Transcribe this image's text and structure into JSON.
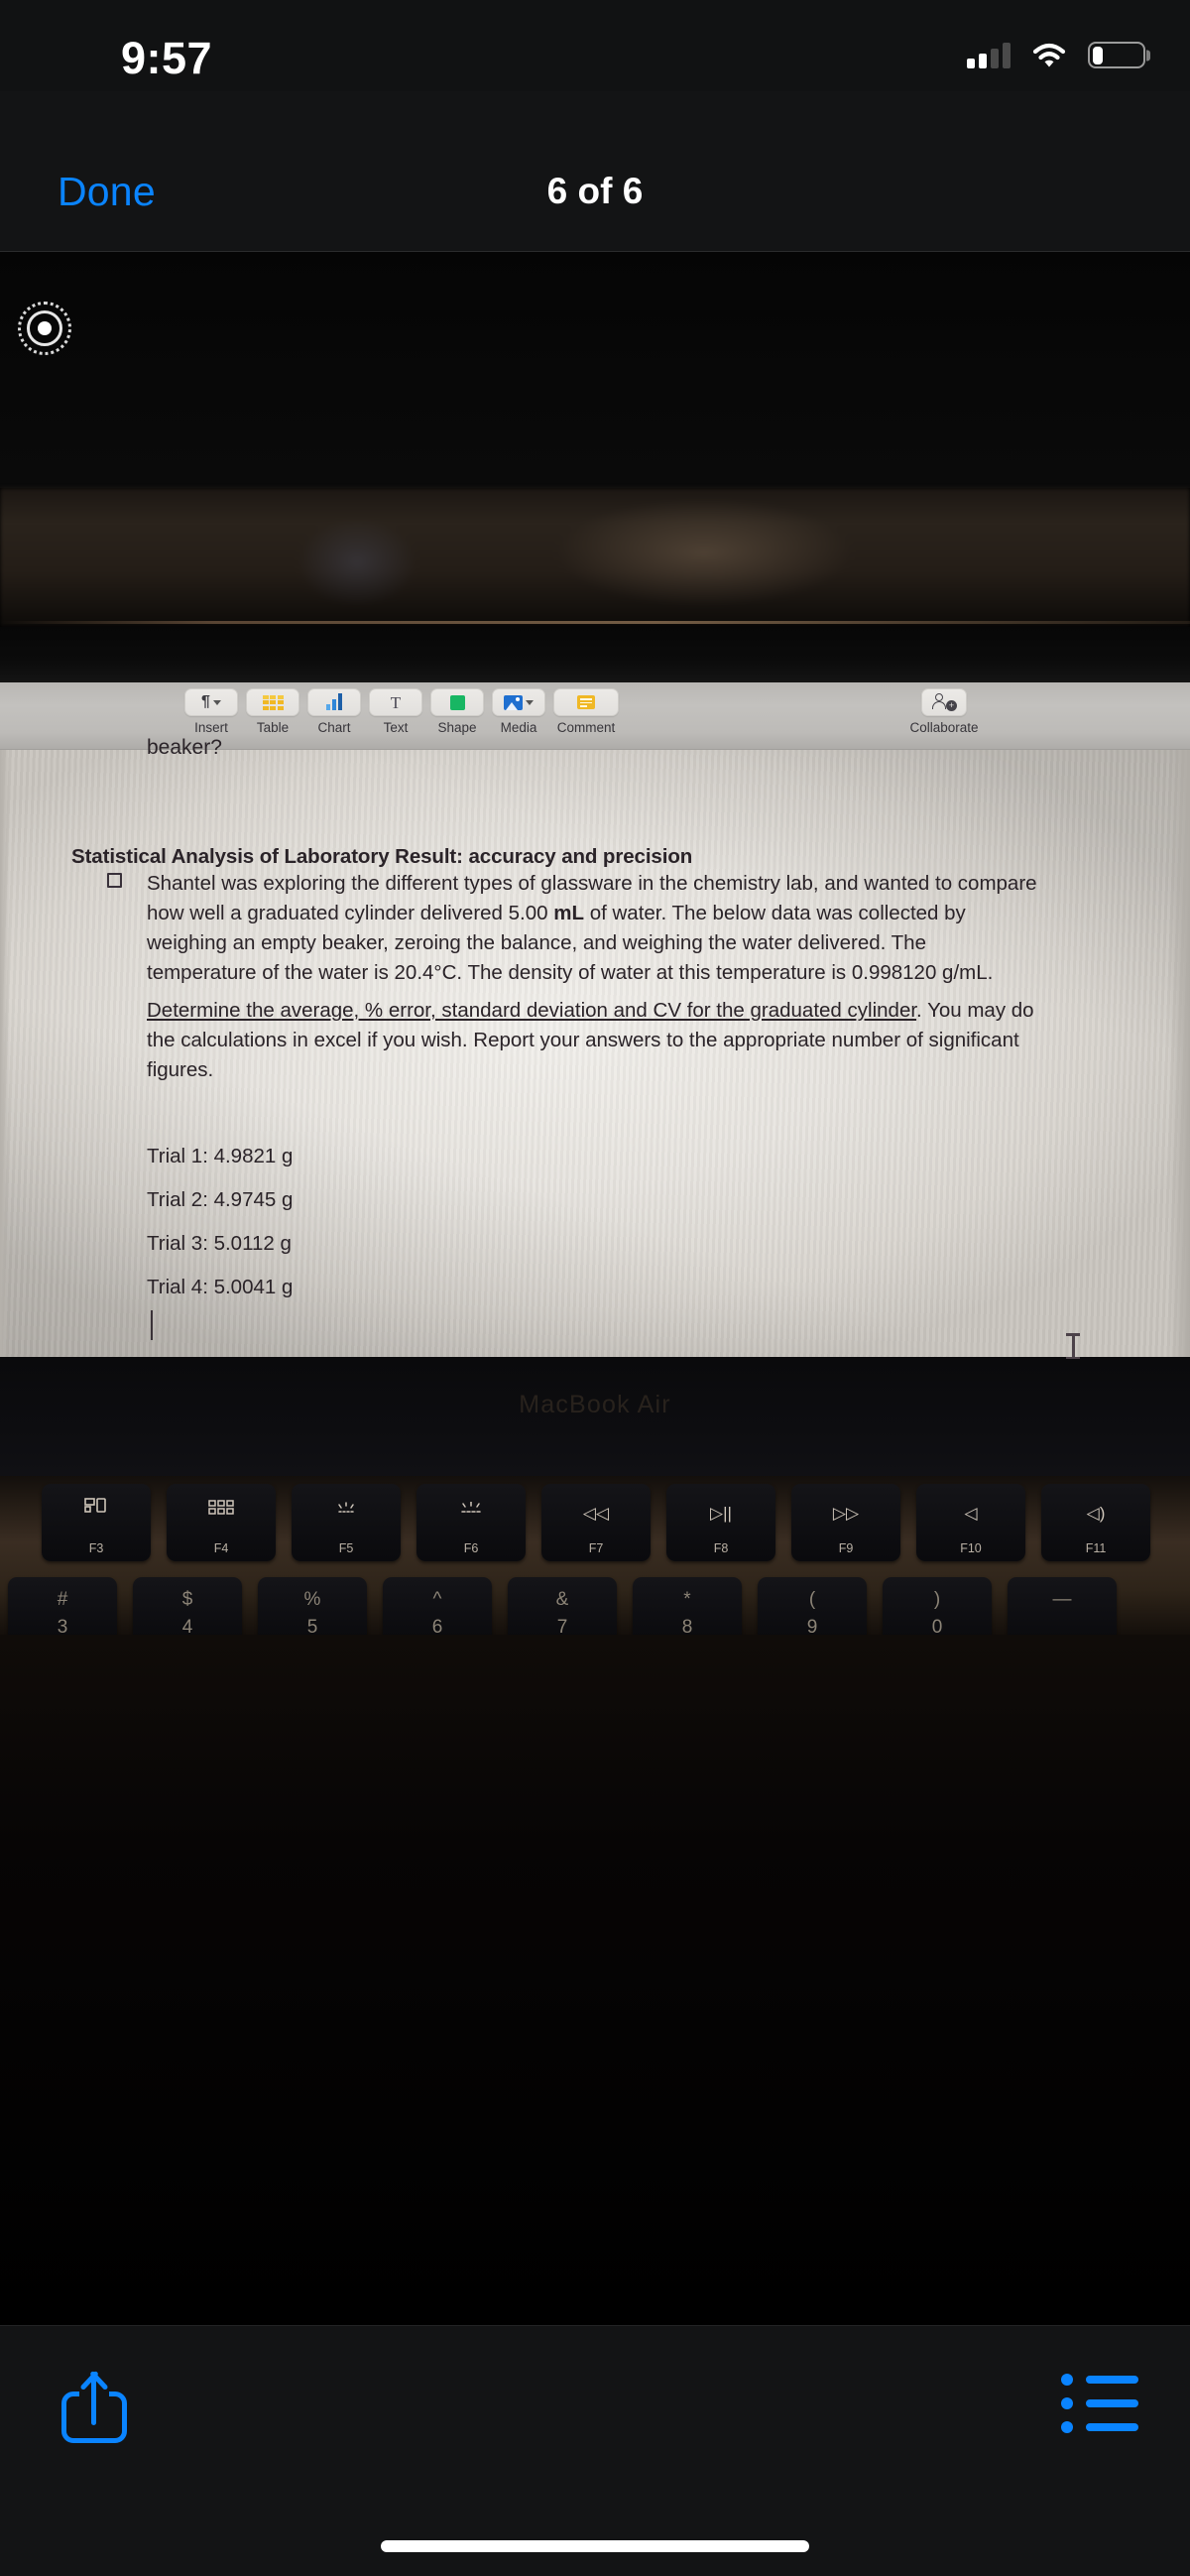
{
  "status_bar": {
    "time": "9:57",
    "cellular_icon": "cellular-signal-icon",
    "cellular_bars_filled": 2,
    "cellular_bars_total": 4,
    "wifi_icon": "wifi-icon",
    "battery_icon": "battery-icon",
    "battery_level_percent": 22
  },
  "nav_bar": {
    "done_label": "Done",
    "title": "6 of 6"
  },
  "photo": {
    "device_label": "MacBook Air",
    "bokeh_icon": "lens-flare-ring-icon",
    "mac_toolbar": {
      "items": [
        {
          "label": "Insert",
          "icon": "paragraph-icon",
          "has_chevron": true
        },
        {
          "label": "Table",
          "icon": "table-icon",
          "has_chevron": false
        },
        {
          "label": "Chart",
          "icon": "bar-chart-icon",
          "has_chevron": false
        },
        {
          "label": "Text",
          "icon": "text-t-icon",
          "has_chevron": false
        },
        {
          "label": "Shape",
          "icon": "shape-square-icon",
          "has_chevron": false
        },
        {
          "label": "Media",
          "icon": "media-image-icon",
          "has_chevron": true
        },
        {
          "label": "Comment",
          "icon": "comment-note-icon",
          "has_chevron": false
        }
      ],
      "collaborate": {
        "label": "Collaborate",
        "icon": "add-person-icon"
      }
    },
    "document": {
      "orphan_line": "beaker?",
      "heading": "Statistical Analysis of Laboratory Result: accuracy and precision",
      "bullet_icon": "empty-checkbox-icon",
      "paragraph_1_part_a": "Shantel was exploring the different types of glassware in the chemistry lab, and wanted to compare how well a graduated cylinder delivered 5.00 ",
      "paragraph_1_bold": "mL",
      "paragraph_1_part_b": " of water. The below data was collected by weighing an empty beaker, zeroing the balance, and weighing the water delivered. The temperature of the water is 20.4°C. The density of water at this temperature is 0.998120 g/mL.",
      "paragraph_2_underlined": "Determine the average, % error, standard deviation and CV for the graduated cylinder",
      "paragraph_2_rest": ". You may do the calculations in excel if you wish. Report your answers to the appropriate number of significant figures.",
      "trials": [
        "Trial 1: 4.9821 g",
        "Trial 2: 4.9745 g",
        "Trial 3: 5.0112 g",
        "Trial 4: 5.0041 g"
      ],
      "text_cursor_icon": "text-caret-icon",
      "mouse_cursor_icon": "i-beam-cursor-icon"
    },
    "keyboard": {
      "function_row": [
        {
          "fn": "F3",
          "glyph": "mission-control-icon"
        },
        {
          "fn": "F4",
          "glyph": "launchpad-grid-icon"
        },
        {
          "fn": "F5",
          "glyph": "keyboard-brightness-down-icon"
        },
        {
          "fn": "F6",
          "glyph": "keyboard-brightness-up-icon"
        },
        {
          "fn": "F7",
          "glyph": "rewind-icon",
          "symbol": "◁◁"
        },
        {
          "fn": "F8",
          "glyph": "play-pause-icon",
          "symbol": "▷||"
        },
        {
          "fn": "F9",
          "glyph": "fast-forward-icon",
          "symbol": "▷▷"
        },
        {
          "fn": "F10",
          "glyph": "mute-icon",
          "symbol": "◁"
        },
        {
          "fn": "F11",
          "glyph": "volume-down-icon",
          "symbol": "◁)"
        }
      ],
      "number_row": [
        {
          "upper": "#",
          "lower": "3"
        },
        {
          "upper": "$",
          "lower": "4"
        },
        {
          "upper": "%",
          "lower": "5"
        },
        {
          "upper": "^",
          "lower": "6"
        },
        {
          "upper": "&",
          "lower": "7"
        },
        {
          "upper": "*",
          "lower": "8"
        },
        {
          "upper": "(",
          "lower": "9"
        },
        {
          "upper": ")",
          "lower": "0"
        },
        {
          "upper": "—",
          "lower": ""
        }
      ]
    }
  },
  "bottom_bar": {
    "share_icon": "share-icon",
    "list_icon": "bulleted-list-icon"
  },
  "colors": {
    "accent_blue": "#0a84ff",
    "background_dark": "#131415",
    "page_paper": "#e7e4df"
  }
}
